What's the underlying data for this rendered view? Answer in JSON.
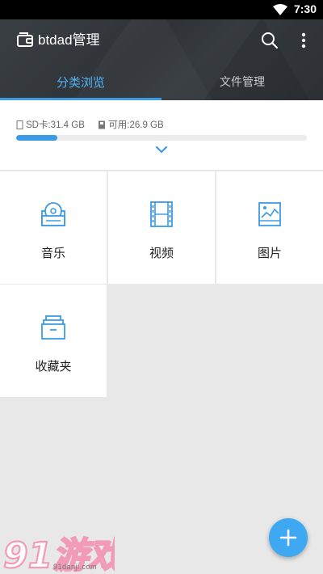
{
  "status_bar": {
    "time": "7:30"
  },
  "app_bar": {
    "title": "btdad管理"
  },
  "tabs": [
    {
      "label": "分类浏览",
      "active": true
    },
    {
      "label": "文件管理",
      "active": false
    }
  ],
  "storage": {
    "sd_label": "SD卡:31.4 GB",
    "available_label": "可用:26.9 GB",
    "used_fraction": 0.143
  },
  "categories": [
    {
      "label": "音乐",
      "icon": "music-disc-icon"
    },
    {
      "label": "视频",
      "icon": "film-icon"
    },
    {
      "label": "图片",
      "icon": "picture-icon"
    },
    {
      "label": "收藏夹",
      "icon": "favorites-box-icon"
    }
  ],
  "watermark": {
    "logo_text": "91游戏",
    "sub_text": "91danji.com"
  },
  "colors": {
    "accent": "#3b9be6",
    "active_tab": "#4fb3f5",
    "fab": "#3ea8f2",
    "header": "#33373c"
  }
}
